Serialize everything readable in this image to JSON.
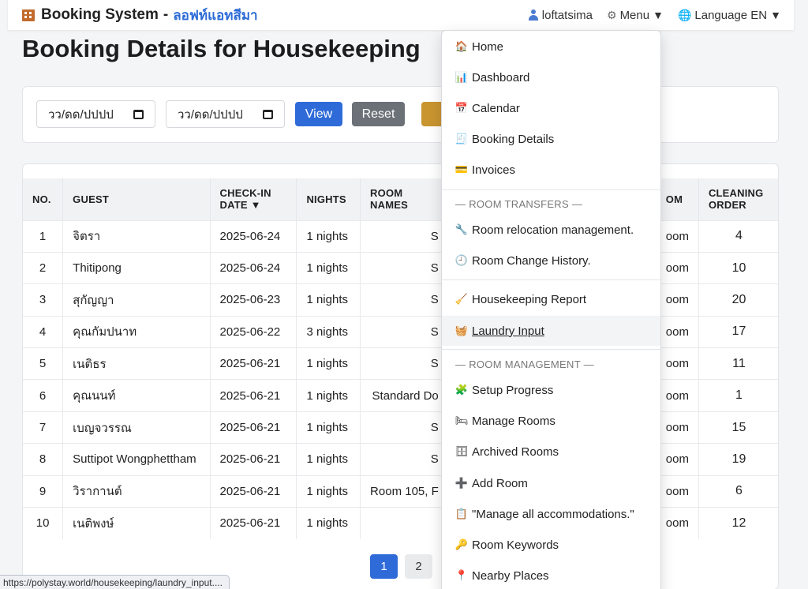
{
  "nav": {
    "brand_title": "Booking System",
    "brand_sep": "-",
    "brand_property": "ลอฟท์แอทสีมา",
    "user": "loftatsima",
    "menu": "Menu",
    "language": "Language EN",
    "caret": "▼"
  },
  "page": {
    "title": "Booking Details for Housekeeping"
  },
  "filters": {
    "start_date_placeholder": "วว/ดด/ปปปป",
    "end_date_placeholder": "วว/ดด/ปปปป",
    "view_label": "View",
    "reset_label": "Reset"
  },
  "table": {
    "headers": [
      "NO.",
      "GUEST",
      "CHECK-IN DATE ▼",
      "NIGHTS",
      "ROOM NAMES",
      "OM",
      "CLEANING ORDER"
    ],
    "rows": [
      {
        "no": "1",
        "guest": "จิตรา",
        "date": "2025-06-24",
        "nights": "1 nights",
        "room": "S",
        "type": "oom",
        "order": "4"
      },
      {
        "no": "2",
        "guest": "Thitipong",
        "date": "2025-06-24",
        "nights": "1 nights",
        "room": "S",
        "type": "oom",
        "order": "10"
      },
      {
        "no": "3",
        "guest": "สุกัญญา",
        "date": "2025-06-23",
        "nights": "1 nights",
        "room": "S",
        "type": "oom",
        "order": "20"
      },
      {
        "no": "4",
        "guest": "คุณกัมปนาท",
        "date": "2025-06-22",
        "nights": "3 nights",
        "room": "S",
        "type": "oom",
        "order": "17"
      },
      {
        "no": "5",
        "guest": "เนติธร",
        "date": "2025-06-21",
        "nights": "1 nights",
        "room": "S",
        "type": "oom",
        "order": "11"
      },
      {
        "no": "6",
        "guest": "คุณนนท์",
        "date": "2025-06-21",
        "nights": "1 nights",
        "room": "Standard Do",
        "type": "oom",
        "order": "1"
      },
      {
        "no": "7",
        "guest": "เบญจวรรณ",
        "date": "2025-06-21",
        "nights": "1 nights",
        "room": "S",
        "type": "oom",
        "order": "15"
      },
      {
        "no": "8",
        "guest": "Suttipot Wongphettham",
        "date": "2025-06-21",
        "nights": "1 nights",
        "room": "S",
        "type": "oom",
        "order": "19"
      },
      {
        "no": "9",
        "guest": "วิรากานต์",
        "date": "2025-06-21",
        "nights": "1 nights",
        "room": "Room 105, F",
        "type": "oom",
        "order": "6"
      },
      {
        "no": "10",
        "guest": "เนติพงษ์",
        "date": "2025-06-21",
        "nights": "1 nights",
        "room": "",
        "type": "oom",
        "order": "12"
      }
    ]
  },
  "pagination": {
    "pages": [
      "1",
      "2"
    ],
    "current": "1"
  },
  "dropdown": {
    "items": [
      {
        "icon": "home-icon",
        "glyph": "🏠",
        "label": "Home"
      },
      {
        "icon": "dashboard-icon",
        "glyph": "📊",
        "label": "Dashboard"
      },
      {
        "icon": "calendar-icon",
        "glyph": "📅",
        "label": "Calendar"
      },
      {
        "icon": "receipt-icon",
        "glyph": "🧾",
        "label": "Booking Details"
      },
      {
        "icon": "card-icon",
        "glyph": "💳",
        "label": "Invoices"
      }
    ],
    "section_transfers": "— ROOM TRANSFERS —",
    "transfers": [
      {
        "icon": "wrench-icon",
        "glyph": "🔧",
        "label": "Room relocation management."
      },
      {
        "icon": "clock-icon",
        "glyph": "🕘",
        "label": "Room Change History."
      }
    ],
    "housekeeping": [
      {
        "icon": "broom-icon",
        "glyph": "🧹",
        "label": "Housekeeping Report"
      },
      {
        "icon": "basket-icon",
        "glyph": "🧺",
        "label": "Laundry Input"
      }
    ],
    "section_management": "— ROOM MANAGEMENT —",
    "management": [
      {
        "icon": "puzzle-icon",
        "glyph": "🧩",
        "label": "Setup Progress"
      },
      {
        "icon": "bed-icon",
        "glyph": "🛏",
        "label": "Manage Rooms"
      },
      {
        "icon": "archive-icon",
        "glyph": "🗄",
        "label": "Archived Rooms"
      },
      {
        "icon": "plus-icon",
        "glyph": "➕",
        "label": "Add Room"
      },
      {
        "icon": "clipboard-icon",
        "glyph": "📋",
        "label": "\"Manage all accommodations.\""
      },
      {
        "icon": "key-icon",
        "glyph": "🔑",
        "label": "Room Keywords"
      },
      {
        "icon": "pin-icon",
        "glyph": "📍",
        "label": "Nearby Places"
      }
    ]
  },
  "status_url": "https://polystay.world/housekeeping/laundry_input...."
}
